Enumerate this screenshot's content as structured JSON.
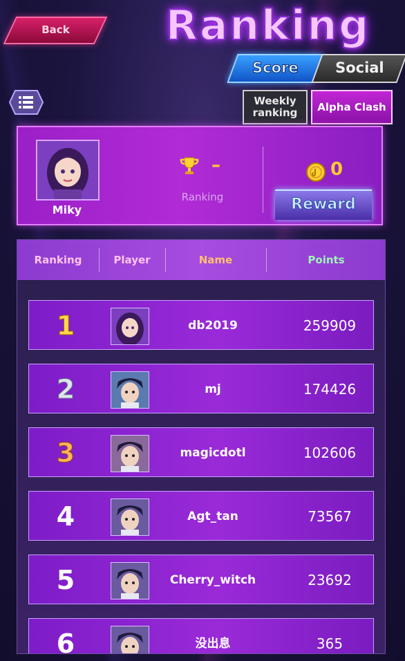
{
  "header": {
    "back_label": "Back",
    "title": "Ranking",
    "tabs": [
      {
        "label": "Score",
        "active": true
      },
      {
        "label": "Social",
        "active": false
      }
    ],
    "subtabs": [
      {
        "label": "Weekly ranking",
        "active": false
      },
      {
        "label": "Alpha Clash",
        "active": true
      }
    ]
  },
  "me": {
    "name": "Miky",
    "rank_value": "–",
    "rank_label": "Ranking",
    "coins": "0",
    "reward_label": "Reward"
  },
  "table": {
    "headers": [
      "Ranking",
      "Player",
      "Name",
      "Points"
    ],
    "rows": [
      {
        "rank": "1",
        "name": "db2019",
        "points": "259909",
        "medal": "gold"
      },
      {
        "rank": "2",
        "name": "mj",
        "points": "174426",
        "medal": "silver"
      },
      {
        "rank": "3",
        "name": "magicdotl",
        "points": "102606",
        "medal": "bronze"
      },
      {
        "rank": "4",
        "name": "Agt_tan",
        "points": "73567",
        "medal": "none"
      },
      {
        "rank": "5",
        "name": "Cherry_witch",
        "points": "23692",
        "medal": "none"
      },
      {
        "rank": "6",
        "name": "没出息",
        "points": "365",
        "medal": "none"
      }
    ]
  },
  "colors": {
    "accent_purple": "#9b1fc8",
    "score_tab_blue": "#3aa0ff",
    "gold": "#ffd84a",
    "points_header": "#9ff3b8",
    "name_header": "#ffbf70"
  },
  "icons": {
    "menu": "menu-icon",
    "trophy": "trophy-icon",
    "coin": "coin-icon"
  }
}
